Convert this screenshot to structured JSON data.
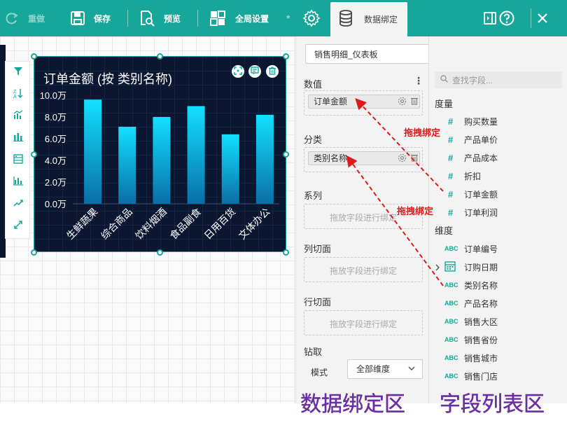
{
  "toolbar": {
    "redo_label": "重做",
    "save_label": "保存",
    "preview_label": "预览",
    "global_settings_label": "全局设置",
    "data_binding_label": "数据绑定"
  },
  "colors": {
    "toolbar_bg": "#16a79a",
    "chart_bg": "#0b1631",
    "bar_top": "#12e0ff",
    "bar_bottom": "#0a6fa6",
    "annotation_red": "#e01a1a",
    "label_purple": "#6b2fa0"
  },
  "side_tools": [
    "filter-icon",
    "sort-icon",
    "combo-chart-icon",
    "bar-chart-icon",
    "table-icon",
    "stats-icon",
    "trend-icon",
    "expand-icon"
  ],
  "chart": {
    "title": "订单金额 (按 类别名称)"
  },
  "chart_data": {
    "type": "bar",
    "title": "订单金额 (按 类别名称)",
    "categories": [
      "生鲜蔬果",
      "综合商品",
      "饮料烟酒",
      "食品副食",
      "日用百货",
      "文体办公"
    ],
    "values": [
      9.6,
      7.1,
      8.0,
      9.0,
      6.4,
      8.2
    ],
    "y_ticks": [
      "0.0万",
      "2.0万",
      "4.0万",
      "6.0万",
      "8.0万",
      "10.0万"
    ],
    "ylim": [
      0,
      10
    ],
    "xlabel": "",
    "ylabel": "",
    "grid": true
  },
  "binding": {
    "dataset": "销售明细_仪表板",
    "values_title": "数值",
    "values_field": "订单金额",
    "category_title": "分类",
    "category_field": "类别名称",
    "series_title": "系列",
    "series_placeholder": "拖放字段进行绑定",
    "col_slice_title": "列切面",
    "col_slice_placeholder": "拖放字段进行绑定",
    "row_slice_title": "行切面",
    "row_slice_placeholder": "拖放字段进行绑定",
    "drill_title": "钻取",
    "mode_label": "模式",
    "mode_value": "全部维度"
  },
  "fields": {
    "search_placeholder": "查找字段...",
    "measures_title": "度量",
    "measures": [
      "购买数量",
      "产品单价",
      "产品成本",
      "折扣",
      "订单金额",
      "订单利润"
    ],
    "dimensions_title": "维度",
    "dimensions": [
      {
        "type": "ABC",
        "name": "订单编号"
      },
      {
        "type": "date",
        "name": "订购日期"
      },
      {
        "type": "ABC",
        "name": "类别名称"
      },
      {
        "type": "ABC",
        "name": "产品名称"
      },
      {
        "type": "ABC",
        "name": "销售大区"
      },
      {
        "type": "ABC",
        "name": "销售省份"
      },
      {
        "type": "ABC",
        "name": "销售城市"
      },
      {
        "type": "ABC",
        "name": "销售门店"
      }
    ]
  },
  "annotations": {
    "drag_bind_1": "拖拽绑定",
    "drag_bind_2": "拖拽绑定",
    "binding_area_label": "数据绑定区",
    "field_list_label": "字段列表区"
  }
}
